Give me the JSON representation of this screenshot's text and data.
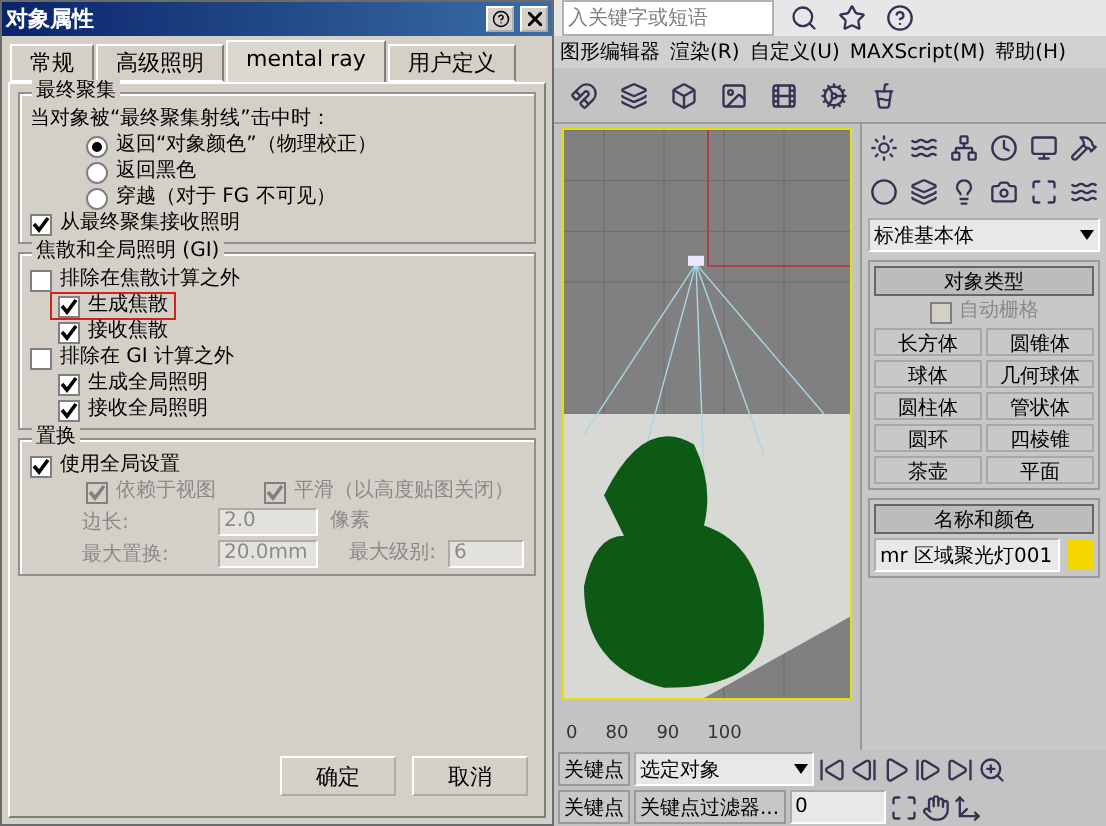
{
  "dialog": {
    "title": "对象属性",
    "tabs": [
      {
        "label": "常规",
        "selected": false
      },
      {
        "label": "高级照明",
        "selected": false
      },
      {
        "label": "mental ray",
        "selected": true
      },
      {
        "label": "用户定义",
        "selected": false
      }
    ],
    "final_gather": {
      "title": "最终聚集",
      "prompt": "当对象被“最终聚集射线”击中时：",
      "options": [
        {
          "label": "返回“对象颜色”（物理校正）",
          "selected": true
        },
        {
          "label": "返回黑色",
          "selected": false
        },
        {
          "label": "穿越（对于 FG 不可见）",
          "selected": false
        }
      ],
      "receive": {
        "label": "从最终聚集接收照明",
        "checked": true
      }
    },
    "caustics_gi": {
      "title": "焦散和全局照明 (GI)",
      "items": [
        {
          "label": "排除在焦散计算之外",
          "checked": false,
          "children": [
            {
              "label": "生成焦散",
              "checked": true,
              "highlighted": true
            },
            {
              "label": "接收焦散",
              "checked": true,
              "highlighted": false
            }
          ]
        },
        {
          "label": "排除在 GI 计算之外",
          "checked": false,
          "children": [
            {
              "label": "生成全局照明",
              "checked": true,
              "highlighted": false
            },
            {
              "label": "接收全局照明",
              "checked": true,
              "highlighted": false
            }
          ]
        }
      ]
    },
    "displacement": {
      "title": "置换",
      "use_global": {
        "label": "使用全局设置",
        "checked": true
      },
      "options": [
        {
          "label": "依赖于视图",
          "checked": true,
          "disabled": true
        },
        {
          "label": "平滑（以高度贴图关闭）",
          "checked": true,
          "disabled": true
        }
      ],
      "edge": {
        "label": "边长:",
        "value": "2.0",
        "unit": "像素",
        "disabled": true
      },
      "max_displace": {
        "label": "最大置换:",
        "value": "20.0mm",
        "disabled": true
      },
      "max_level": {
        "label": "最大级别:",
        "value": "6",
        "disabled": true
      }
    },
    "buttons": [
      "确定",
      "取消"
    ]
  },
  "search": {
    "placeholder": "入关键字或短语"
  },
  "menu": [
    "图形编辑器",
    "渲染(R)",
    "自定义(U)",
    "MAXScript(M)",
    "帮助(H)"
  ],
  "command_panel": {
    "category": "标准基本体",
    "object_type": {
      "title": "对象类型",
      "autogrid": {
        "label": "自动栅格",
        "checked": false,
        "disabled": true
      },
      "buttons": [
        "长方体",
        "圆锥体",
        "球体",
        "几何球体",
        "圆柱体",
        "管状体",
        "圆环",
        "四棱锥",
        "茶壶",
        "平面"
      ]
    },
    "name_color": {
      "title": "名称和颜色",
      "name": "mr 区域聚光灯001",
      "color": "#f5d800"
    }
  },
  "timeline": {
    "ticks": [
      "0",
      "80",
      "90",
      "100"
    ]
  },
  "key_controls": {
    "set_key": "关键点",
    "auto_key": "关键点",
    "selection": "选定对象",
    "filters": "关键点过滤器...",
    "frame": "0"
  }
}
